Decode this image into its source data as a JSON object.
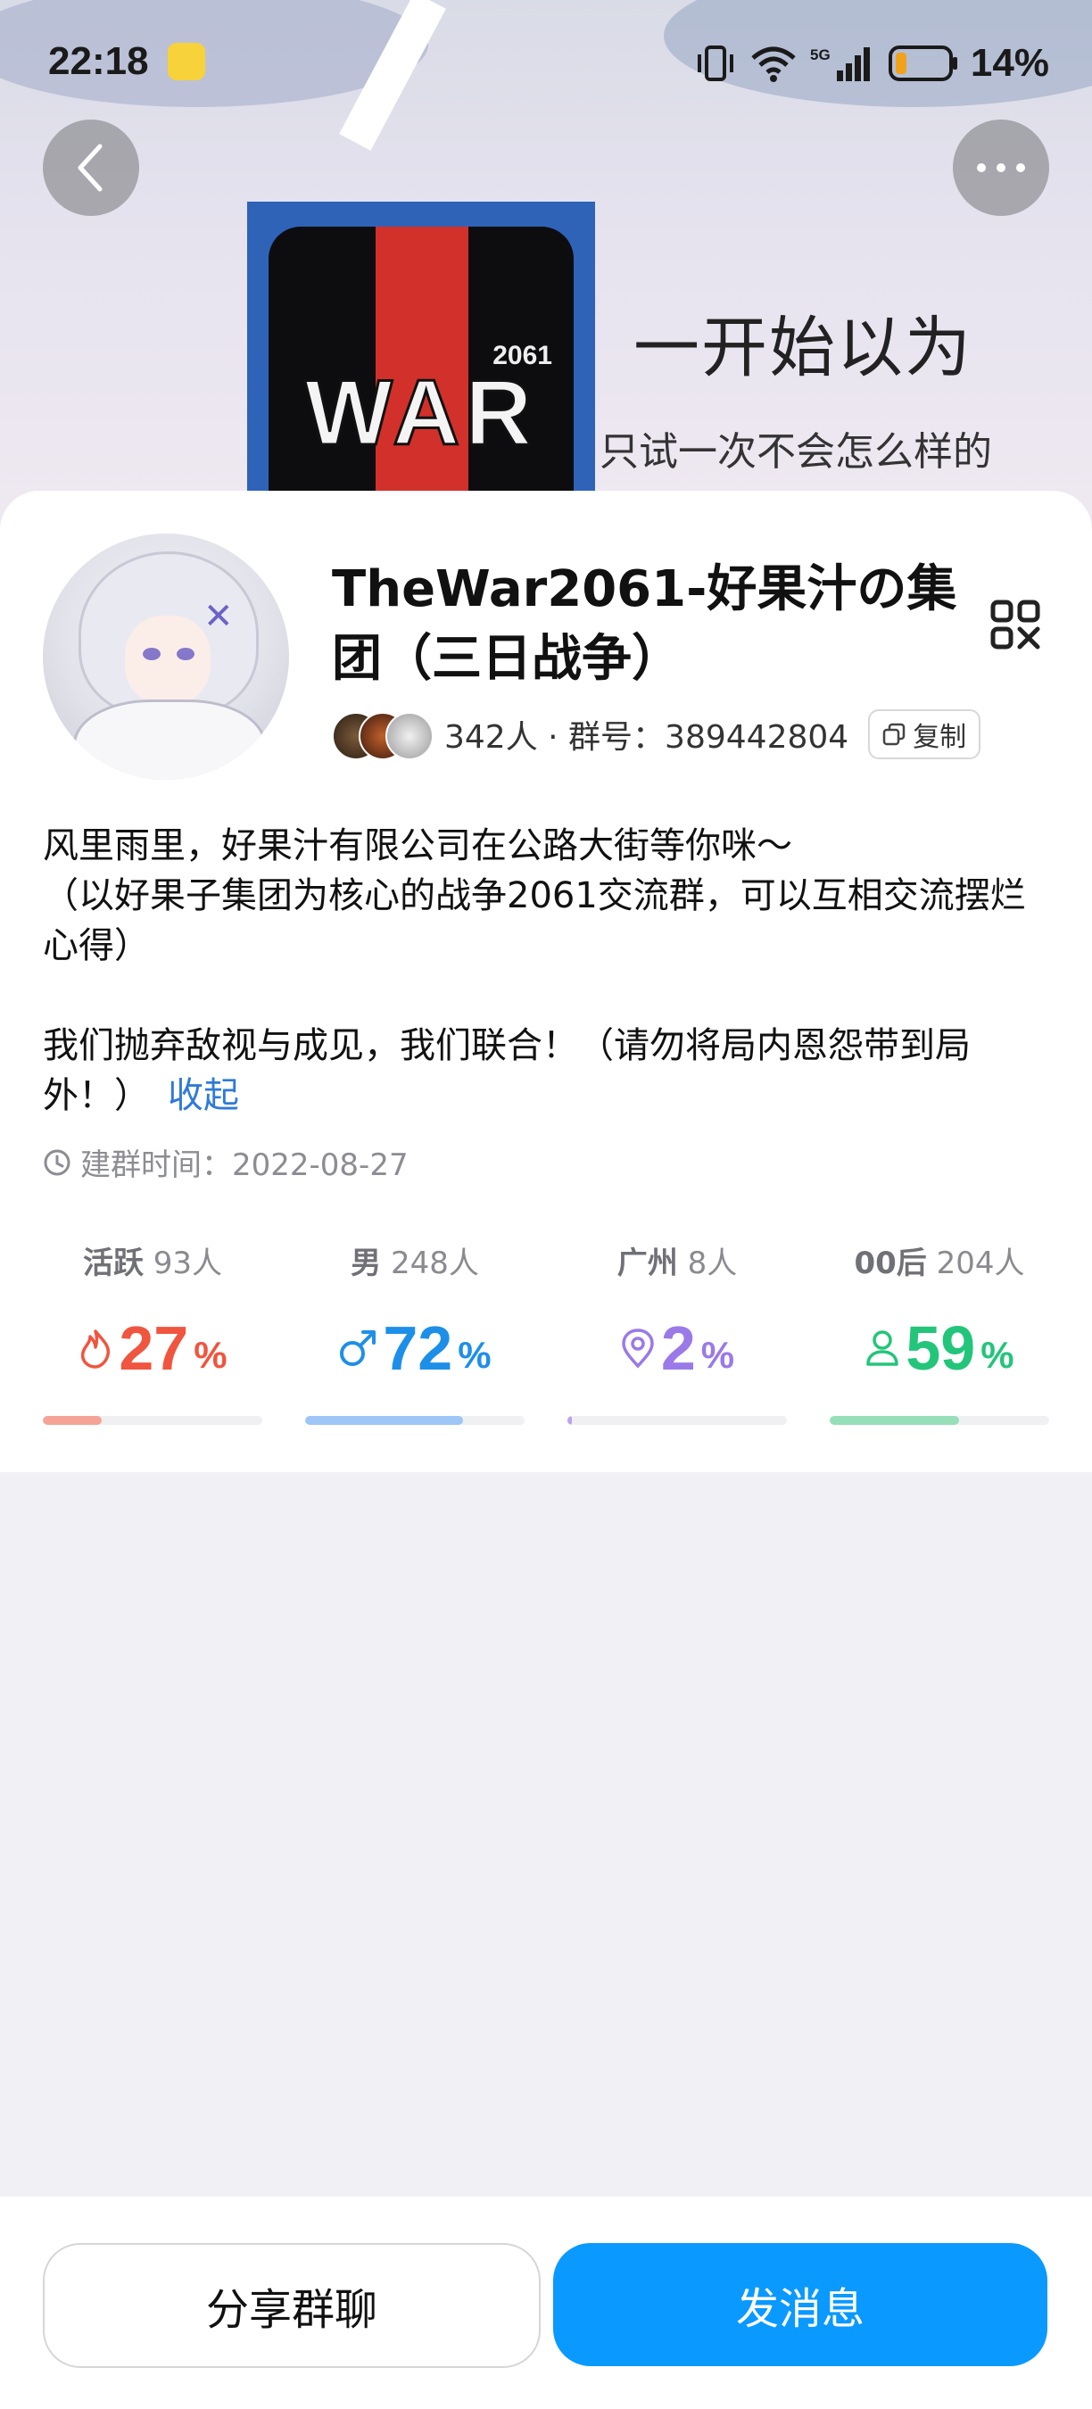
{
  "status_bar": {
    "time": "22:18",
    "battery_pct": "14%",
    "network": "5G"
  },
  "hero": {
    "logo_text": "WAR",
    "logo_year": "2061",
    "caption_line1": "一开始以为",
    "caption_line2": "只试一次不会怎么样的"
  },
  "group": {
    "title": "TheWar2061-好果汁の集团（三日战争）",
    "members": "342人",
    "group_number_label": "群号：",
    "group_number": "389442804",
    "meta_text": "342人 · 群号：389442804",
    "copy_label": "复制",
    "desc_line1": "风里雨里，好果汁有限公司在公路大街等你咪～",
    "desc_line2": "（以好果子集团为核心的战争2061交流群，可以互相交流摆烂心得）",
    "desc_line3": "我们抛弃敌视与成见，我们联合！（请勿将局内恩怨带到局外！）",
    "collapse_label": "收起",
    "created_label": "建群时间：2022-08-27"
  },
  "stats": [
    {
      "label": "活跃",
      "count": "93人",
      "value": "27",
      "unit": "%",
      "color": "#f0553f",
      "track_color": "#f4a396",
      "fraction": 0.27,
      "icon": "flame-icon"
    },
    {
      "label": "男",
      "count": "248人",
      "value": "72",
      "unit": "%",
      "color": "#1e8fe8",
      "track_color": "#9ec6f6",
      "fraction": 0.72,
      "icon": "male-icon"
    },
    {
      "label": "广州",
      "count": "8人",
      "value": "2",
      "unit": "%",
      "color": "#9a7ae8",
      "track_color": "#b9a4ee",
      "fraction": 0.02,
      "icon": "location-icon"
    },
    {
      "label": "00后",
      "count": "204人",
      "value": "59",
      "unit": "%",
      "color": "#23c57a",
      "track_color": "#96dfb8",
      "fraction": 0.59,
      "icon": "person-icon"
    }
  ],
  "actions": {
    "share_label": "分享群聊",
    "send_label": "发消息"
  },
  "colors": {
    "primary": "#0a99ff",
    "link": "#2f7ad8"
  }
}
